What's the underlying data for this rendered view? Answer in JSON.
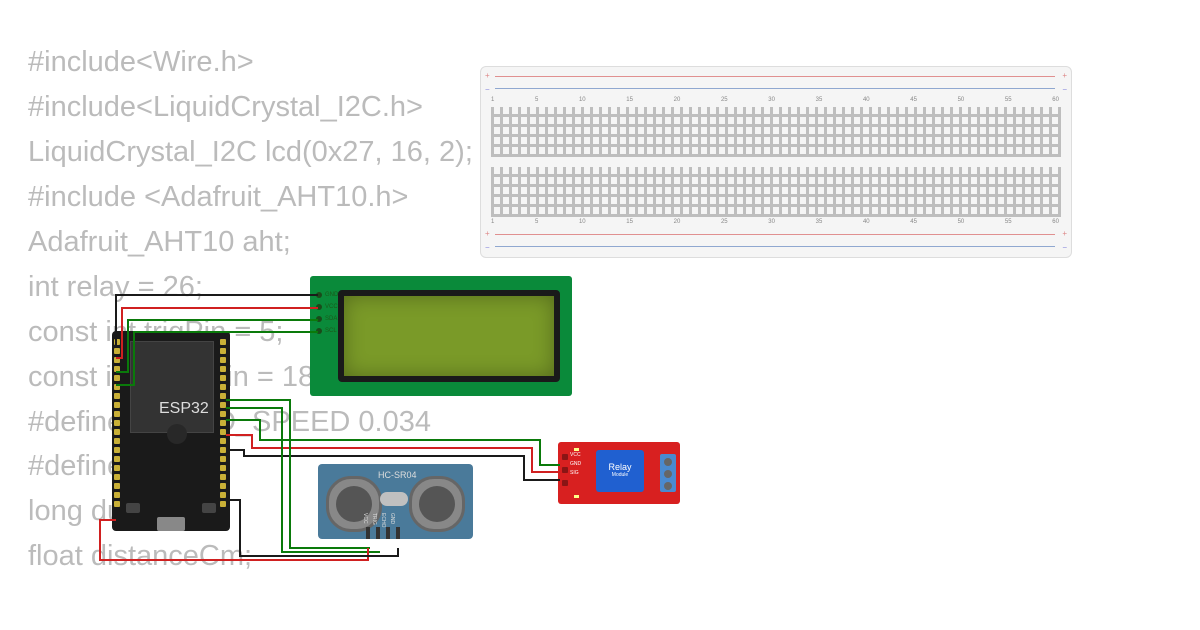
{
  "code": {
    "lines": [
      "#include<Wire.h>",
      "#include<LiquidCrystal_I2C.h>",
      "LiquidCrystal_I2C lcd(0x27, 16, 2);",
      "#include <Adafruit_AHT10.h>",
      "Adafruit_AHT10 aht;",
      "int relay = 26;",
      "const int trigPin = 5;",
      "const int echoPin = 18;",
      "#define SOUND_SPEED 0.034",
      "#define ch 1",
      "long duration;",
      "float distanceCm;"
    ]
  },
  "esp32": {
    "label": "ESP32"
  },
  "lcd": {
    "pins": [
      "GND",
      "VCC",
      "SDA",
      "SCL"
    ]
  },
  "hcsr": {
    "label": "HC-SR04",
    "pins": [
      "VCC",
      "TRIG",
      "ECHO",
      "GND"
    ]
  },
  "relay": {
    "block_label": "Relay",
    "block_sub": "Module",
    "input_pins": [
      "VCC",
      "GND",
      "SIG"
    ],
    "leds": [
      "PWR",
      "SIG"
    ]
  },
  "breadboard": {
    "col_numbers": [
      "1",
      "5",
      "10",
      "15",
      "20",
      "25",
      "30",
      "35",
      "40",
      "45",
      "50",
      "55",
      "60"
    ]
  },
  "circuit_connections": [
    {
      "from": "ESP32 3V3",
      "to": "LCD VCC",
      "color": "red"
    },
    {
      "from": "ESP32 GND",
      "to": "LCD GND",
      "color": "black"
    },
    {
      "from": "ESP32 SDA",
      "to": "LCD SDA",
      "color": "green"
    },
    {
      "from": "ESP32 SCL",
      "to": "LCD SCL",
      "color": "green"
    },
    {
      "from": "ESP32 GPIO5",
      "to": "HC-SR04 TRIG",
      "color": "green"
    },
    {
      "from": "ESP32 GPIO18",
      "to": "HC-SR04 ECHO",
      "color": "green"
    },
    {
      "from": "ESP32 5V",
      "to": "HC-SR04 VCC",
      "color": "red"
    },
    {
      "from": "ESP32 GND",
      "to": "HC-SR04 GND",
      "color": "black"
    },
    {
      "from": "ESP32 GPIO26",
      "to": "Relay SIG",
      "color": "green"
    },
    {
      "from": "ESP32 5V",
      "to": "Relay VCC",
      "color": "red"
    },
    {
      "from": "ESP32 GND",
      "to": "Relay GND",
      "color": "black"
    }
  ]
}
